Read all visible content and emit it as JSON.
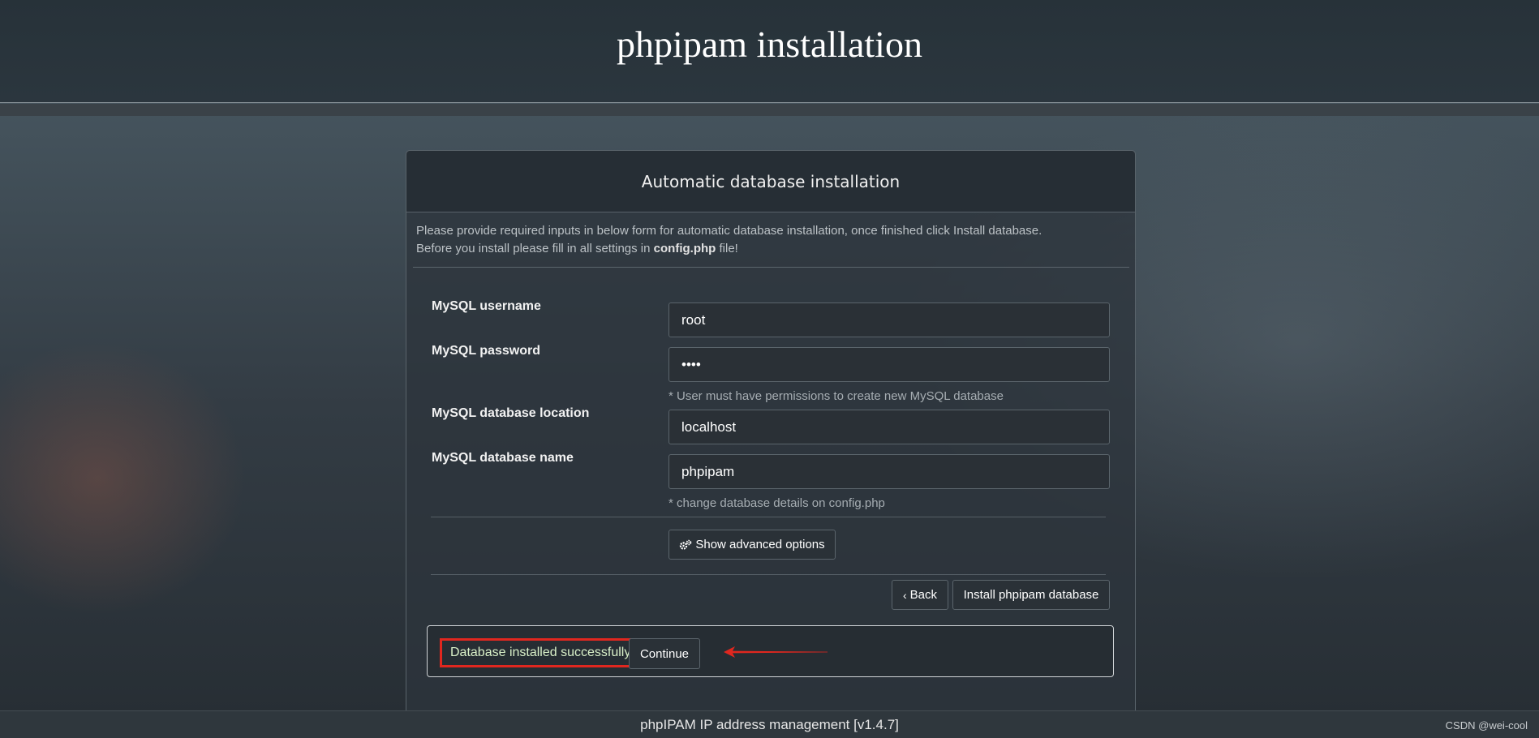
{
  "header": {
    "title": "phpipam installation"
  },
  "panel": {
    "title": "Automatic database installation",
    "intro_line1": "Please provide required inputs in below form for automatic database installation, once finished click Install database.",
    "intro_line2_prefix": "Before you install please fill in all settings in ",
    "intro_line2_bold": "config.php",
    "intro_line2_suffix": " file!"
  },
  "form": {
    "username_label": "MySQL username",
    "username_value": "root",
    "password_label": "MySQL password",
    "password_value": "root",
    "password_help": "* User must have permissions to create new MySQL database",
    "location_label": "MySQL database location",
    "location_value": "localhost",
    "dbname_label": "MySQL database name",
    "dbname_value": "phpipam",
    "dbname_help": "* change database details on config.php",
    "advanced_button": "Show advanced options",
    "back_button": "Back",
    "install_button": "Install phpipam database"
  },
  "result": {
    "message": "Database installed successfully!",
    "continue_button": "Continue",
    "highlight_color": "#e0271f"
  },
  "footer": {
    "text": "phpIPAM IP address management [v1.4.7]"
  },
  "watermark": "CSDN @wei-cool"
}
